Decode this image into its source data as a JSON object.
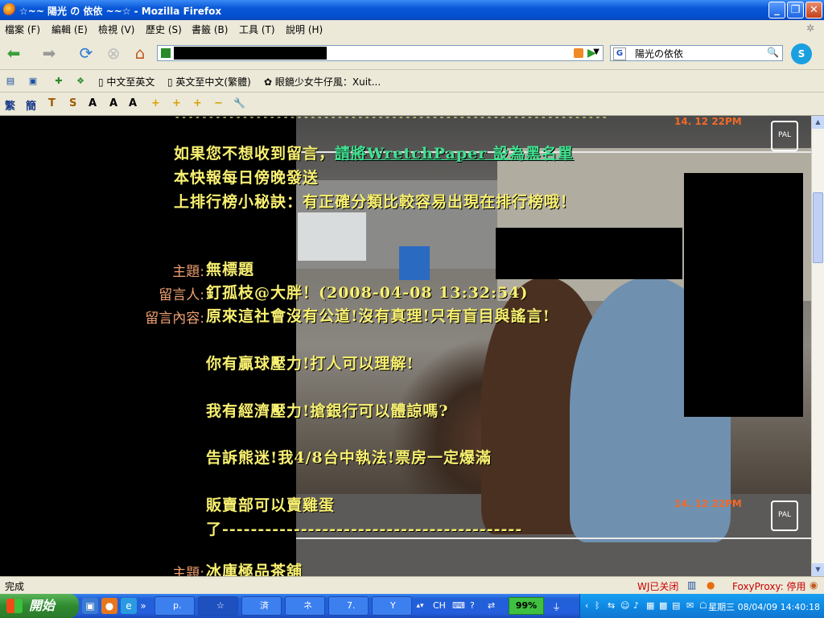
{
  "window": {
    "title": "☆~~ 陽光 の 依依 ~~☆ - Mozilla Firefox",
    "min": "_",
    "max": "❐",
    "close": "✕"
  },
  "menu": [
    "檔案 (F)",
    "編輯 (E)",
    "檢視 (V)",
    "歷史 (S)",
    "書籤 (B)",
    "工具 (T)",
    "說明 (H)"
  ],
  "search": {
    "engine_icon": "google-icon",
    "value": "陽光の依依"
  },
  "bookmarks": [
    {
      "label": "中文至英文"
    },
    {
      "label": "英文至中文(繁體)"
    },
    {
      "label": "眼鏡少女牛仔風：Xuit..."
    }
  ],
  "toolbar2": [
    "繁",
    "簡",
    "T",
    "S",
    "A",
    "A",
    "A",
    "+",
    "+",
    "+",
    "−",
    "🔧"
  ],
  "content": {
    "dashes": "----------------------------------------------------------------",
    "lines": [
      {
        "text_a": "如果您不想收到留言，",
        "link": "請將WretchPaper 設為黑名單"
      },
      {
        "text": "本快報每日傍晚發送"
      },
      {
        "text": "上排行榜小秘訣：有正確分類比較容易出現在排行榜哦！"
      }
    ],
    "post1": {
      "subject_label": "主題:",
      "subject": "無標題",
      "author_label": "留言人:",
      "author": "釘孤枝@大胖！(2008-04-08 13:32:54)",
      "body_label": "留言內容:",
      "body": [
        "原來這社會沒有公道!沒有真理!只有盲目與謠言!",
        "你有贏球壓力!打人可以理解!",
        "我有經濟壓力!搶銀行可以體諒嗎?",
        "告訴熊迷!我4/8台中執法!票房一定爆滿",
        "販賣部可以賣雞蛋",
        "了------------------------------------------"
      ]
    },
    "post2": {
      "subject_label": "主題:",
      "subject": "冰庫極品茶舖"
    },
    "photo_stamp": "14. 12 22PM",
    "photo_logo": "PAL"
  },
  "status": {
    "left": "完成",
    "wj": "WJ已关闭",
    "foxy": "FoxyProxy: 停用"
  },
  "taskbar": {
    "start": "開始",
    "tasks": [
      "p.",
      "☆",
      "済",
      "ネ",
      "7.",
      "Y"
    ],
    "lang": "CH",
    "battery": "99%",
    "clock": "星期三 08/04/09 14:40:18"
  }
}
